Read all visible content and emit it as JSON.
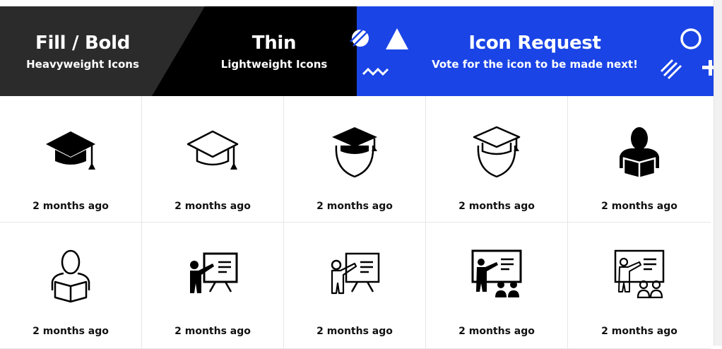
{
  "tabs": [
    {
      "title": "Fill / Bold",
      "subtitle": "Heavyweight Icons"
    },
    {
      "title": "Thin",
      "subtitle": "Lightweight Icons"
    },
    {
      "title": "Icon Request",
      "subtitle": "Vote for the icon to be made next!"
    }
  ],
  "colors": {
    "fill_tab": "#2b2b2b",
    "thin_tab": "#000000",
    "request_tab": "#1a44e6"
  },
  "icons": [
    {
      "name": "graduation-cap-fill-icon",
      "time": "2 months ago"
    },
    {
      "name": "graduation-cap-thin-icon",
      "time": "2 months ago"
    },
    {
      "name": "student-graduate-fill-icon",
      "time": "2 months ago"
    },
    {
      "name": "student-graduate-thin-icon",
      "time": "2 months ago"
    },
    {
      "name": "reader-fill-icon",
      "time": "2 months ago"
    },
    {
      "name": "reader-thin-icon",
      "time": "2 months ago"
    },
    {
      "name": "teacher-board-fill-icon",
      "time": "2 months ago"
    },
    {
      "name": "teacher-board-thin-icon",
      "time": "2 months ago"
    },
    {
      "name": "classroom-fill-icon",
      "time": "2 months ago"
    },
    {
      "name": "classroom-thin-icon",
      "time": "2 months ago"
    }
  ]
}
